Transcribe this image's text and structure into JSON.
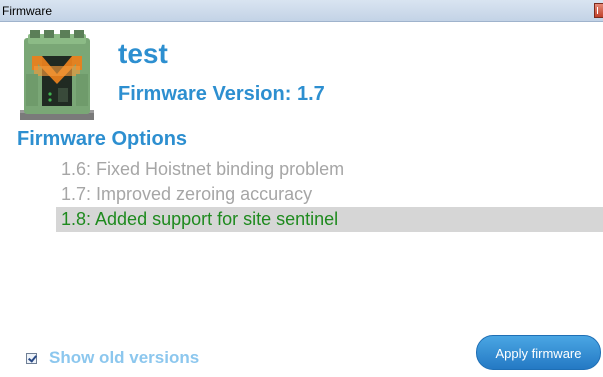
{
  "window": {
    "title": "Firmware"
  },
  "device": {
    "name": "test",
    "icon": "din-rail-module-icon",
    "firmware_version_label": "Firmware Version: 1.7"
  },
  "options": {
    "heading": "Firmware Options",
    "items": [
      {
        "label": "1.6: Fixed Hoistnet binding problem",
        "selected": false
      },
      {
        "label": "1.7: Improved zeroing accuracy",
        "selected": false
      },
      {
        "label": "1.8: Added support for site sentinel",
        "selected": true
      }
    ]
  },
  "footer": {
    "show_old_versions_label": "Show old versions",
    "show_old_versions_checked": true,
    "apply_button_label": "Apply firmware"
  },
  "colors": {
    "accent": "#2d8fd0",
    "selected_text": "#1e8a1e",
    "muted_text": "#a6a6a6",
    "button": "#2479c4"
  }
}
